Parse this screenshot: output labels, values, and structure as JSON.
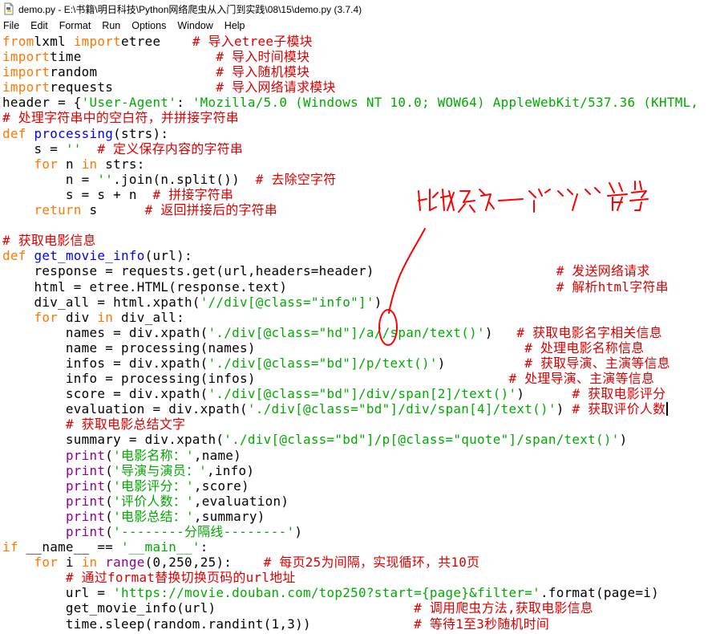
{
  "window": {
    "title": "demo.py - E:\\书籍\\明日科技\\Python网络爬虫从入门到实践\\08\\15\\demo.py (3.7.4)"
  },
  "menu": [
    "File",
    "Edit",
    "Format",
    "Run",
    "Options",
    "Window",
    "Help"
  ],
  "icons": {
    "app": "python-file-icon"
  },
  "colors": {
    "keyword": "#ff7700",
    "builtin": "#900090",
    "string": "#00aa00",
    "comment": "#dd0000",
    "definition": "#0000ff",
    "annotation_ink": "#ff0000"
  },
  "code_lines": [
    [
      [
        "kw",
        "from"
      ],
      [
        "",
        "lxml "
      ],
      [
        "kw",
        "import"
      ],
      [
        "",
        "etree    "
      ],
      [
        "cm",
        "# 导入etree子模块"
      ]
    ],
    [
      [
        "kw",
        "import"
      ],
      [
        "",
        "time                 "
      ],
      [
        "cm",
        "# 导入时间模块"
      ]
    ],
    [
      [
        "kw",
        "import"
      ],
      [
        "",
        "random               "
      ],
      [
        "cm",
        "# 导入随机模块"
      ]
    ],
    [
      [
        "kw",
        "import"
      ],
      [
        "",
        "requests             "
      ],
      [
        "cm",
        "# 导入网络请求模块"
      ]
    ],
    [
      [
        "",
        "header = {"
      ],
      [
        "st",
        "'User-Agent'"
      ],
      [
        "",
        ": "
      ],
      [
        "st",
        "'Mozilla/5.0 (Windows NT 10.0; WOW64) AppleWebKit/537.36 (KHTML,"
      ]
    ],
    [
      [
        "cm",
        "# 处理字符串中的空白符，并拼接字符串"
      ]
    ],
    [
      [
        "kw",
        "def"
      ],
      [
        "",
        " "
      ],
      [
        "df",
        "processing"
      ],
      [
        "",
        "(strs):"
      ]
    ],
    [
      [
        "",
        "    s = "
      ],
      [
        "st",
        "''"
      ],
      [
        "",
        "  "
      ],
      [
        "cm",
        "# 定义保存内容的字符串"
      ]
    ],
    [
      [
        "",
        "    "
      ],
      [
        "kw",
        "for"
      ],
      [
        "",
        " n "
      ],
      [
        "kw",
        "in"
      ],
      [
        "",
        " strs:"
      ]
    ],
    [
      [
        "",
        "        n = "
      ],
      [
        "st",
        "''"
      ],
      [
        "",
        ".join(n.split())  "
      ],
      [
        "cm",
        "# 去除空字符"
      ]
    ],
    [
      [
        "",
        "        s = s + n  "
      ],
      [
        "cm",
        "# 拼接字符串"
      ]
    ],
    [
      [
        "",
        "    "
      ],
      [
        "kw",
        "return"
      ],
      [
        "",
        " s      "
      ],
      [
        "cm",
        "# 返回拼接后的字符串"
      ]
    ],
    [],
    [
      [
        "cm",
        "# 获取电影信息"
      ]
    ],
    [
      [
        "kw",
        "def"
      ],
      [
        "",
        " "
      ],
      [
        "df",
        "get_movie_info"
      ],
      [
        "",
        "(url):"
      ]
    ],
    [
      [
        "",
        "    response = requests.get(url,headers=header)                       "
      ],
      [
        "cm",
        "# 发送网络请求"
      ]
    ],
    [
      [
        "",
        "    html = etree.HTML(response.text)                                  "
      ],
      [
        "cm",
        "# 解析html字符串"
      ]
    ],
    [
      [
        "",
        "    div_all = html.xpath("
      ],
      [
        "st",
        "'//div[@class=\"info\"]'"
      ],
      [
        "",
        ")"
      ]
    ],
    [
      [
        "",
        "    "
      ],
      [
        "kw",
        "for"
      ],
      [
        "",
        " div "
      ],
      [
        "kw",
        "in"
      ],
      [
        "",
        " div_all:"
      ]
    ],
    [
      [
        "",
        "        names = div.xpath("
      ],
      [
        "st",
        "'./div[@class=\"hd\"]/a//span/text()'"
      ],
      [
        "",
        ")   "
      ],
      [
        "cm",
        "# 获取电影名字相关信息"
      ]
    ],
    [
      [
        "",
        "        name = processing(names)                                  "
      ],
      [
        "cm",
        "# 处理电影名称信息"
      ]
    ],
    [
      [
        "",
        "        infos = div.xpath("
      ],
      [
        "st",
        "'./div[@class=\"bd\"]/p/text()'"
      ],
      [
        "",
        ")          "
      ],
      [
        "cm",
        "# 获取导演、主演等信息"
      ]
    ],
    [
      [
        "",
        "        info = processing(infos)                                "
      ],
      [
        "cm",
        "# 处理导演、主演等信息"
      ]
    ],
    [
      [
        "",
        "        score = div.xpath("
      ],
      [
        "st",
        "'./div[@class=\"bd\"]/div/span[2]/text()'"
      ],
      [
        "",
        ")      "
      ],
      [
        "cm",
        "# 获取电影评分"
      ]
    ],
    [
      [
        "",
        "        evaluation = div.xpath("
      ],
      [
        "st",
        "'./div[@class=\"bd\"]/div/span[4]/text()'"
      ],
      [
        "",
        ") "
      ],
      [
        "cm",
        "# 获取评价人数"
      ]
    ],
    [
      [
        "",
        "        "
      ],
      [
        "cm",
        "# 获取电影总结文字"
      ]
    ],
    [
      [
        "",
        "        summary = div.xpath("
      ],
      [
        "st",
        "'./div[@class=\"bd\"]/p[@class=\"quote\"]/span/text()'"
      ],
      [
        "",
        ")"
      ]
    ],
    [
      [
        "",
        "        "
      ],
      [
        "bi",
        "print"
      ],
      [
        "",
        "("
      ],
      [
        "st",
        "'电影名称：'"
      ],
      [
        "",
        ",name)"
      ]
    ],
    [
      [
        "",
        "        "
      ],
      [
        "bi",
        "print"
      ],
      [
        "",
        "("
      ],
      [
        "st",
        "'导演与演员：'"
      ],
      [
        "",
        ",info)"
      ]
    ],
    [
      [
        "",
        "        "
      ],
      [
        "bi",
        "print"
      ],
      [
        "",
        "("
      ],
      [
        "st",
        "'电影评分：'"
      ],
      [
        "",
        ",score)"
      ]
    ],
    [
      [
        "",
        "        "
      ],
      [
        "bi",
        "print"
      ],
      [
        "",
        "("
      ],
      [
        "st",
        "'评价人数：'"
      ],
      [
        "",
        ",evaluation)"
      ]
    ],
    [
      [
        "",
        "        "
      ],
      [
        "bi",
        "print"
      ],
      [
        "",
        "("
      ],
      [
        "st",
        "'电影总结：'"
      ],
      [
        "",
        ",summary)"
      ]
    ],
    [
      [
        "",
        "        "
      ],
      [
        "bi",
        "print"
      ],
      [
        "",
        "("
      ],
      [
        "st",
        "'--------分隔线--------'"
      ],
      [
        "",
        ")"
      ]
    ],
    [
      [
        "kw",
        "if"
      ],
      [
        "",
        " __name__ == "
      ],
      [
        "st",
        "'__main__'"
      ],
      [
        "",
        ":"
      ]
    ],
    [
      [
        "",
        "    "
      ],
      [
        "kw",
        "for"
      ],
      [
        "",
        " i "
      ],
      [
        "kw",
        "in"
      ],
      [
        "",
        " "
      ],
      [
        "bi",
        "range"
      ],
      [
        "",
        "(0,250,25):    "
      ],
      [
        "cm",
        "# 每页25为间隔，实现循环，共10页"
      ]
    ],
    [
      [
        "",
        "        "
      ],
      [
        "cm",
        "# 通过format替换切换页码的url地址"
      ]
    ],
    [
      [
        "",
        "        url = "
      ],
      [
        "st",
        "'https://movie.douban.com/top250?start={page}&filter='"
      ],
      [
        "",
        ".format(page=i)"
      ]
    ],
    [
      [
        "",
        "        get_movie_info(url)                         "
      ],
      [
        "cm",
        "# 调用爬虫方法,获取电影信息"
      ]
    ],
    [
      [
        "",
        "        time.sleep(random.randint(1,3))             "
      ],
      [
        "cm",
        "# 等待1至3秒随机时间"
      ]
    ]
  ],
  "cursor_line": 24,
  "handwritten_note": "此处多了一个\"/\"符号"
}
